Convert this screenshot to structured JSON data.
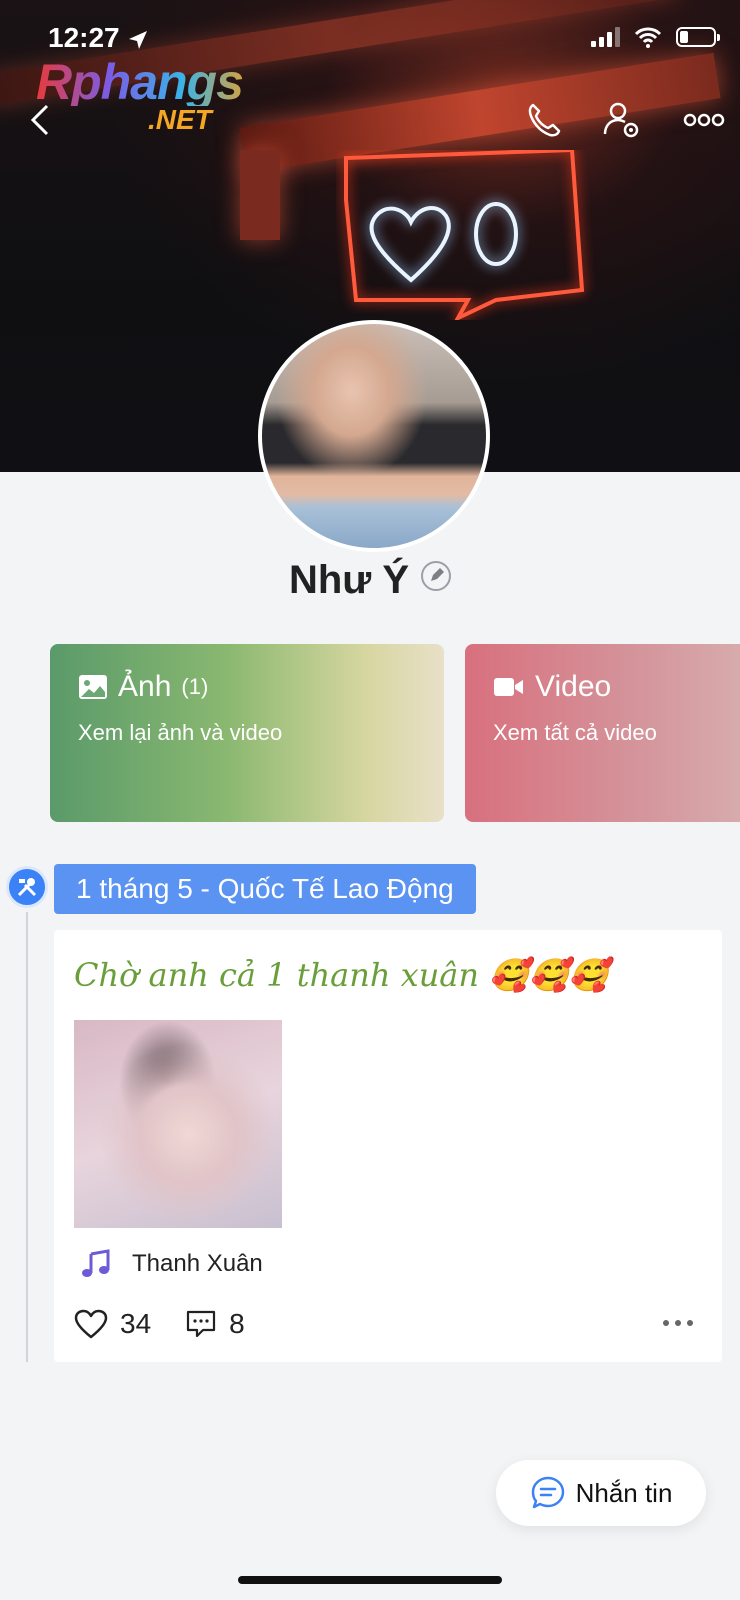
{
  "status_bar": {
    "time": "12:27"
  },
  "watermark": {
    "line1": "Rphangs",
    "line2": ".NET"
  },
  "profile": {
    "name": "Như Ý"
  },
  "cards": [
    {
      "title": "Ảnh",
      "count": "(1)",
      "subtitle": "Xem lại ảnh và video"
    },
    {
      "title": "Video",
      "subtitle": "Xem tất cả video"
    }
  ],
  "timeline": {
    "milestone": "1 tháng 5 - Quốc Tế Lao Động",
    "post": {
      "caption": "Chờ anh cả 1 thanh xuân 🥰🥰🥰",
      "music": "Thanh Xuân",
      "likes": "34",
      "comments": "8"
    }
  },
  "message_button": {
    "label": "Nhắn tin"
  },
  "colors": {
    "accent": "#3b82f6",
    "milestone_bg": "#5b93f2",
    "caption": "#6a9e3a",
    "photos_card": "#5a9a6a",
    "video_card": "#d8707e"
  }
}
